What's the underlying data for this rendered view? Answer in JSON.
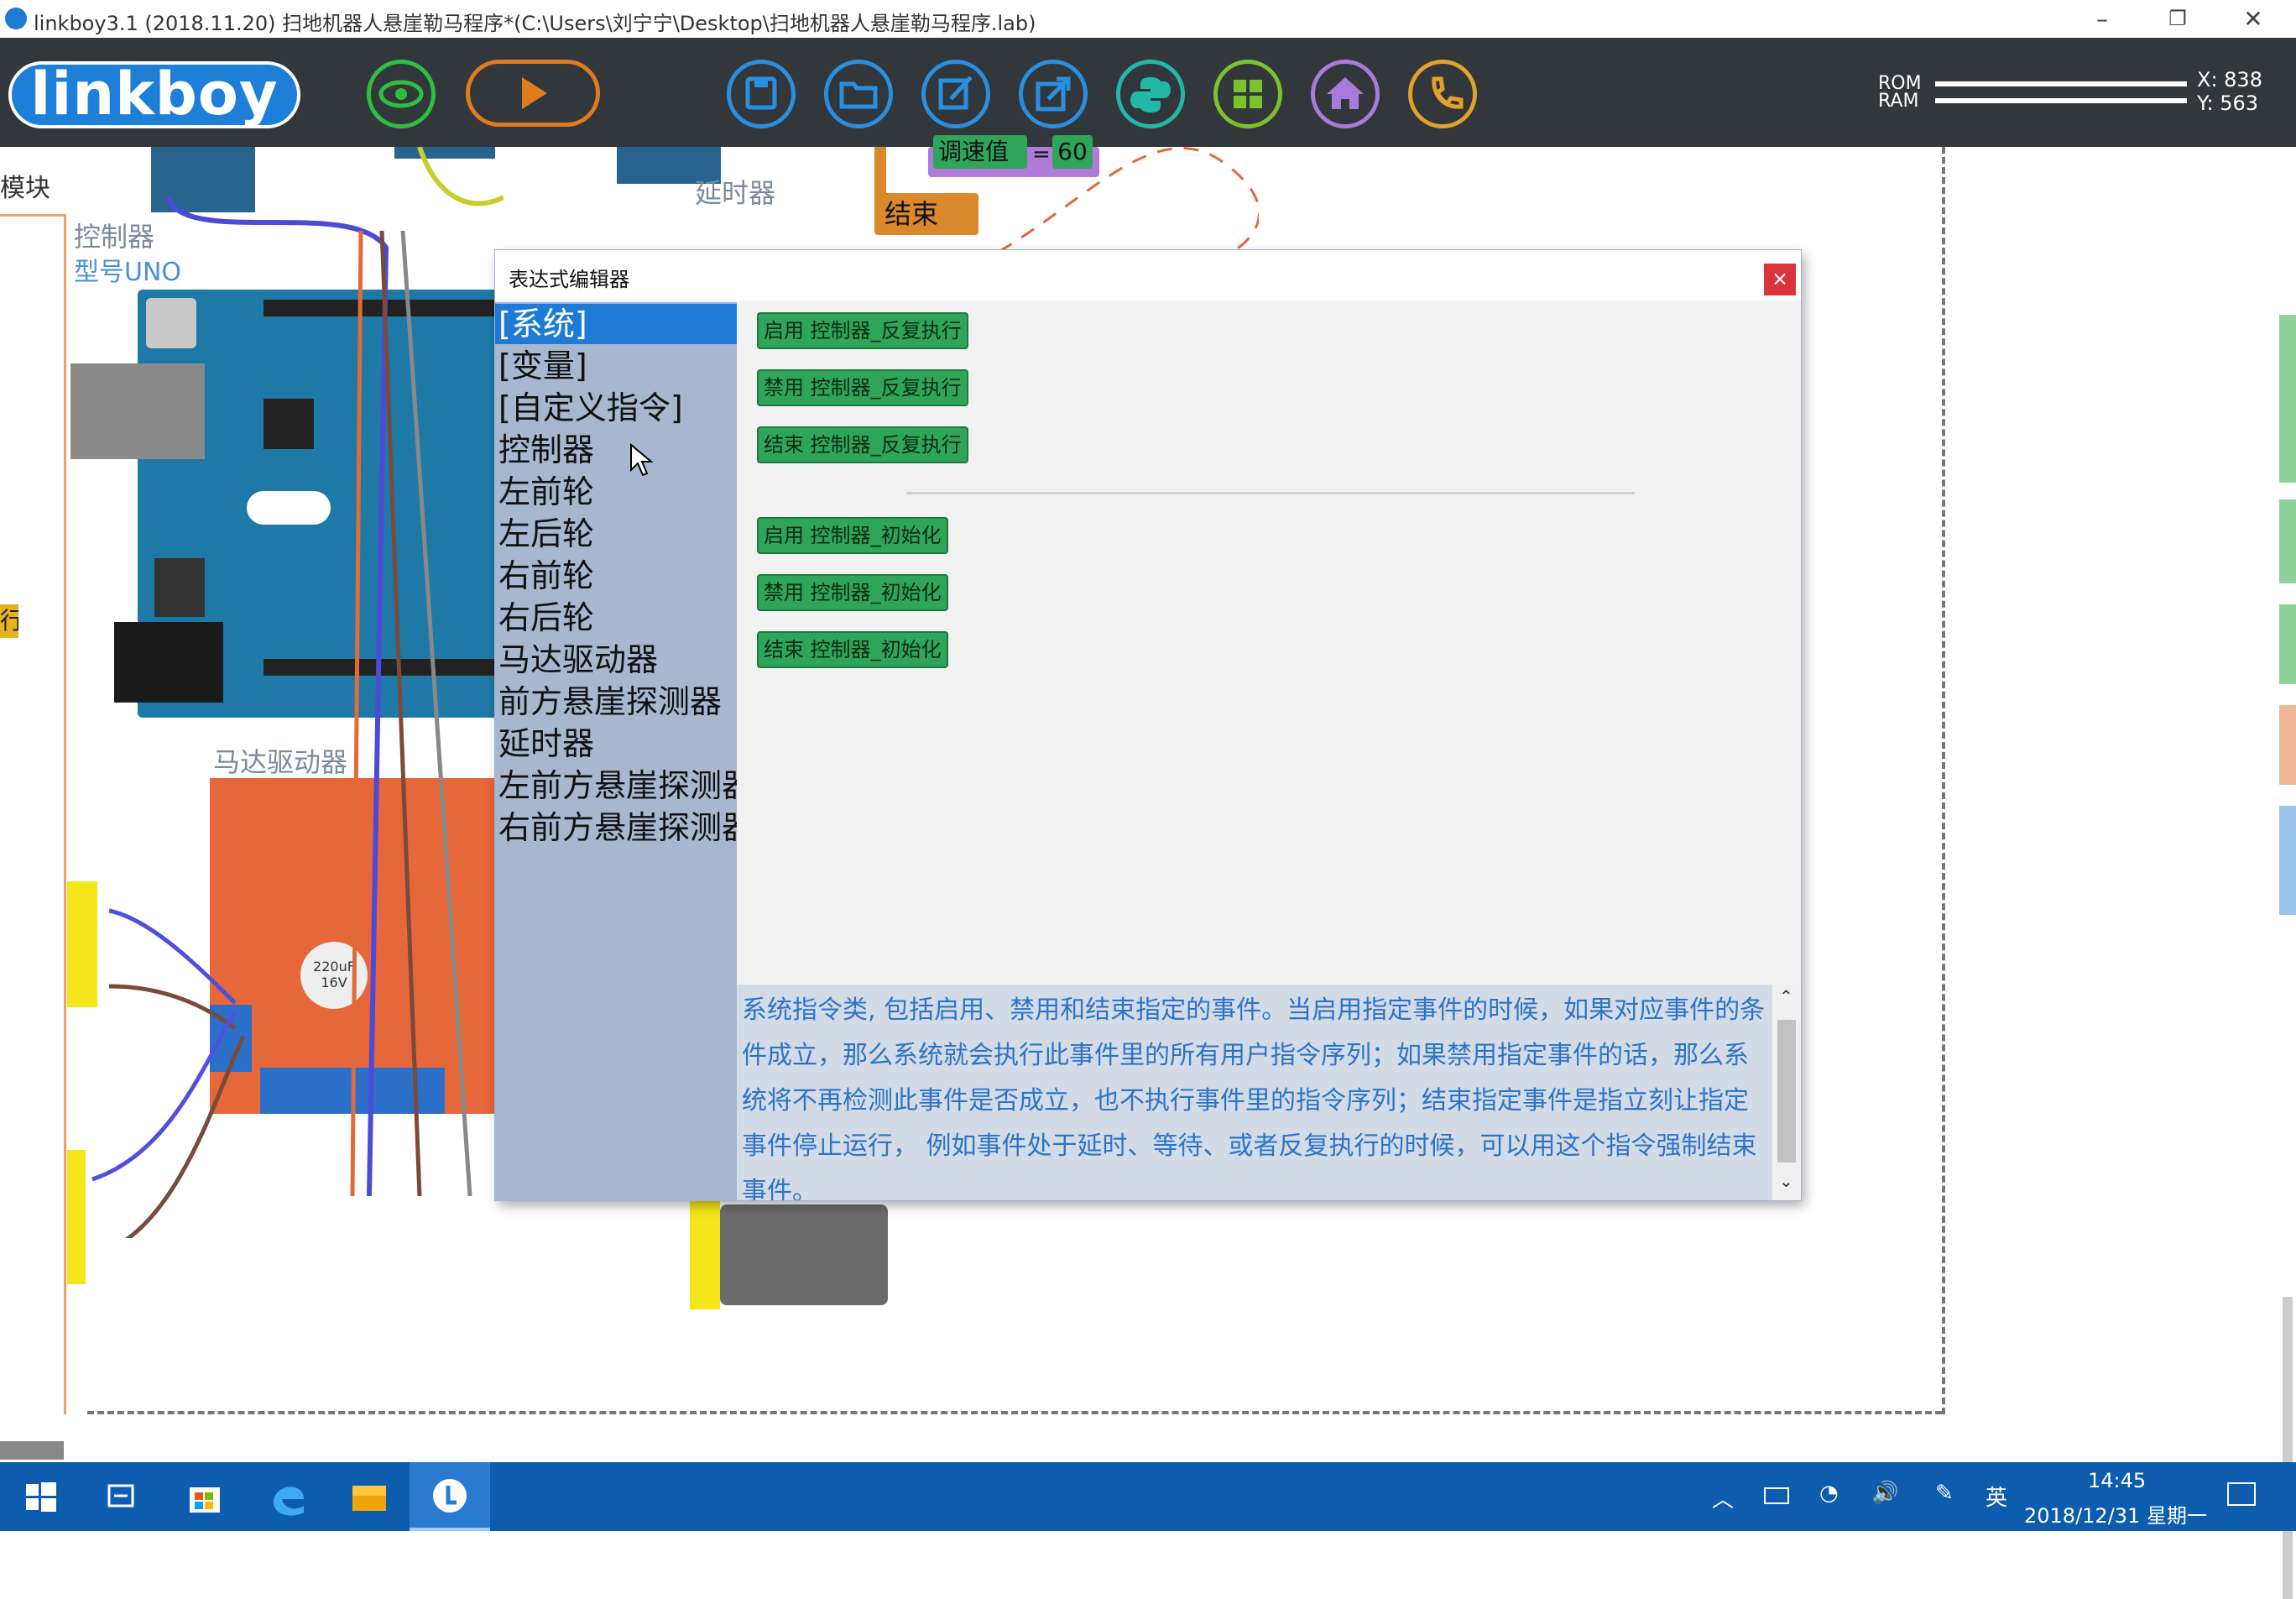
{
  "window": {
    "title": "linkboy3.1 (2018.11.20) 扫地机器人悬崖勒马程序*(C:\\Users\\刘宁宁\\Desktop\\扫地机器人悬崖勒马程序.lab)"
  },
  "toolbar": {
    "logo_text": "linkboy",
    "buttons": [
      {
        "name": "view-eye",
        "icon": "eye-icon",
        "color": "#2fbf3f"
      },
      {
        "name": "run",
        "icon": "play-icon",
        "color": "#e07b1e"
      },
      {
        "name": "save",
        "icon": "save-icon",
        "color": "#2b8fe0"
      },
      {
        "name": "open",
        "icon": "folder-icon",
        "color": "#2b8fe0"
      },
      {
        "name": "edit",
        "icon": "edit-icon",
        "color": "#2b8fe0"
      },
      {
        "name": "export",
        "icon": "export-icon",
        "color": "#2b8fe0"
      },
      {
        "name": "python",
        "icon": "python-icon",
        "color": "#22b8a8"
      },
      {
        "name": "modules",
        "icon": "grid-icon",
        "color": "#7cc22e"
      },
      {
        "name": "home",
        "icon": "home-icon",
        "color": "#a87ad9"
      },
      {
        "name": "phone",
        "icon": "phone-icon",
        "color": "#e0a22b"
      }
    ],
    "rom_label": "ROM",
    "ram_label": "RAM",
    "x_readout": "X: 838",
    "y_readout": "Y: 563"
  },
  "canvas": {
    "label_module_partial": "模块",
    "label_controller": "控制器",
    "label_controller_model": "型号UNO",
    "label_motor_driver": "马达驱动器",
    "label_delay": "延时器",
    "label_end": "结束",
    "label_speed": "调速值",
    "label_equals": "=",
    "label_speed_value": "60",
    "label_run_partial": "行",
    "cap_label_1": "220uF",
    "cap_label_2": "16V"
  },
  "dialog": {
    "title": "表达式编辑器",
    "close_symbol": "×",
    "categories": [
      {
        "label": "[系统]",
        "selected": true
      },
      {
        "label": "[变量]",
        "selected": false
      },
      {
        "label": "[自定义指令]",
        "selected": false
      },
      {
        "label": "控制器",
        "selected": false
      },
      {
        "label": "左前轮",
        "selected": false
      },
      {
        "label": "左后轮",
        "selected": false
      },
      {
        "label": "右前轮",
        "selected": false
      },
      {
        "label": "右后轮",
        "selected": false
      },
      {
        "label": "马达驱动器",
        "selected": false
      },
      {
        "label": "前方悬崖探测器",
        "selected": false
      },
      {
        "label": "延时器",
        "selected": false
      },
      {
        "label": "左前方悬崖探测器",
        "selected": false
      },
      {
        "label": "右前方悬崖探测器",
        "selected": false
      }
    ],
    "commands_group1": [
      "启用 控制器_反复执行",
      "禁用 控制器_反复执行",
      "结束 控制器_反复执行"
    ],
    "commands_group2": [
      "启用 控制器_初始化",
      "禁用 控制器_初始化",
      "结束 控制器_初始化"
    ],
    "description": "系统指令类, 包括启用、禁用和结束指定的事件。当启用指定事件的时候，如果对应事件的条件成立，那么系统就会执行此事件里的所有用户指令序列；如果禁用指定事件的话，那么系统将不再检测此事件是否成立，也不执行事件里的指令序列；结束指定事件是指立刻让指定事件停止运行， 例如事件处于延时、等待、或者反复执行的时候，可以用这个指令强制结束事件。"
  },
  "taskbar": {
    "ime": "英",
    "time": "14:45",
    "date": "2018/12/31 星期一"
  }
}
